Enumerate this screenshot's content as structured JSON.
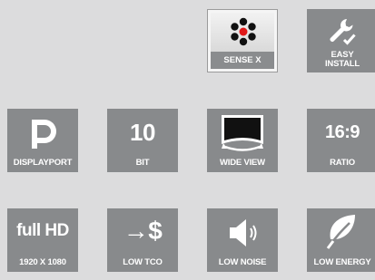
{
  "tiles": {
    "sense_x": {
      "label": "SENSE X",
      "icon": "sensor-icon"
    },
    "easy_install": {
      "label_line1": "EASY",
      "label_line2": "INSTALL",
      "icon": "wrench-check-icon"
    },
    "displayport": {
      "label": "DISPLAYPORT",
      "icon": "displayport-logo-icon"
    },
    "bit": {
      "value": "10",
      "label": "BIT"
    },
    "wide_view": {
      "label": "WIDE VIEW",
      "icon": "wide-view-monitor-icon"
    },
    "ratio": {
      "value": "16:9",
      "label": "RATIO"
    },
    "full_hd": {
      "value": "full HD",
      "label": "1920 X 1080"
    },
    "low_tco": {
      "value": "→$",
      "label": "LOW TCO",
      "icon": "arrow-dollar-icon"
    },
    "low_noise": {
      "label": "LOW NOISE",
      "icon": "speaker-icon"
    },
    "low_energy": {
      "label": "LOW ENERGY",
      "icon": "leaf-icon"
    }
  },
  "colors": {
    "background": "#dcdcdd",
    "tile": "#888a8c",
    "sense_accent": "#e01818"
  }
}
